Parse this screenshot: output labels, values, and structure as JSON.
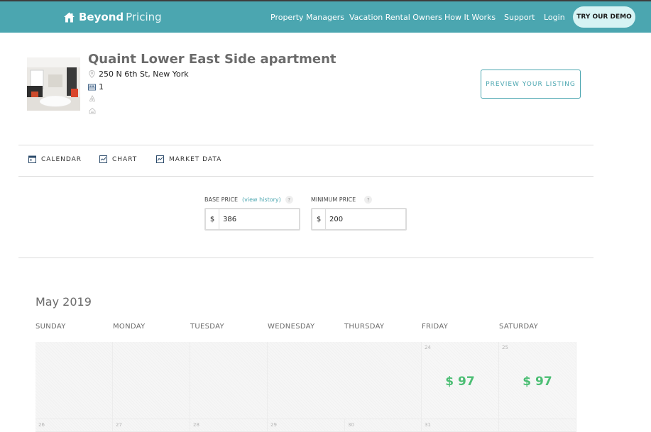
{
  "nav": {
    "brand_bold": "Beyond",
    "brand_light": "Pricing",
    "links": [
      "Property Managers",
      "Vacation Rental Owners",
      "How It Works",
      "Support",
      "Login"
    ],
    "cta": "TRY OUR DEMO",
    "bar_color": "#4ba6b0"
  },
  "listing": {
    "title": "Quaint Lower East Side apartment",
    "address": "250 N 6th St, New York",
    "bedrooms": "1",
    "icons": [
      "map-pin-icon",
      "bed-icon",
      "airbnb-icon",
      "homeaway-icon"
    ],
    "preview_button": "PREVIEW YOUR LISTING"
  },
  "tabs": [
    {
      "label": "CALENDAR",
      "icon": "calendar-icon"
    },
    {
      "label": "CHART",
      "icon": "chart-icon"
    },
    {
      "label": "MARKET DATA",
      "icon": "market-data-icon"
    }
  ],
  "pricing": {
    "base_label": "BASE PRICE",
    "history_link": "(view history)",
    "help": "?",
    "base_currency": "$",
    "base_value": "386",
    "min_label": "MINIMUM PRICE",
    "min_currency": "$",
    "min_value": "200"
  },
  "calendar": {
    "month": "May 2019",
    "weekdays": [
      "SUNDAY",
      "MONDAY",
      "TUESDAY",
      "WEDNESDAY",
      "THURSDAY",
      "FRIDAY",
      "SATURDAY"
    ],
    "week1": [
      {
        "day": "",
        "price": ""
      },
      {
        "day": "",
        "price": ""
      },
      {
        "day": "",
        "price": ""
      },
      {
        "day": "",
        "price": ""
      },
      {
        "day": "",
        "price": ""
      },
      {
        "day": "24",
        "price": "$ 97"
      },
      {
        "day": "25",
        "price": "$ 97"
      }
    ],
    "week2": [
      "26",
      "27",
      "28",
      "29",
      "30",
      "31",
      ""
    ],
    "price_color": "#4cbe74"
  }
}
